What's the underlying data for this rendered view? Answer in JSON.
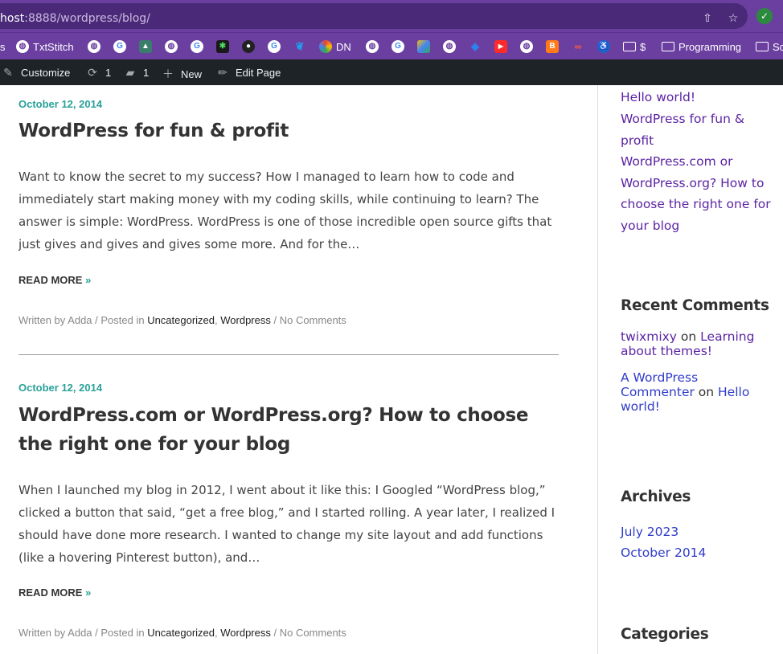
{
  "browser": {
    "url_host": "host",
    "url_rest": ":8888/wordpress/blog/",
    "bookmarks": [
      {
        "label": "s",
        "icon": "partial-icon"
      },
      {
        "label": "TxtStitch",
        "icon": "globe-icon"
      },
      {
        "label": "",
        "icon": "globe-icon"
      },
      {
        "label": "",
        "icon": "google-icon"
      },
      {
        "label": "",
        "icon": "app-icon"
      },
      {
        "label": "",
        "icon": "globe-icon"
      },
      {
        "label": "",
        "icon": "google-icon"
      },
      {
        "label": "",
        "icon": "app-icon"
      },
      {
        "label": "",
        "icon": "ghost-icon"
      },
      {
        "label": "",
        "icon": "google-icon"
      },
      {
        "label": "",
        "icon": "twitter-icon"
      },
      {
        "label": "DN",
        "icon": "dn-icon"
      },
      {
        "label": "",
        "icon": "globe-icon"
      },
      {
        "label": "",
        "icon": "google-icon"
      },
      {
        "label": "",
        "icon": "google-ads-icon"
      },
      {
        "label": "",
        "icon": "globe-icon"
      },
      {
        "label": "",
        "icon": "dropbox-icon"
      },
      {
        "label": "",
        "icon": "youtube-icon"
      },
      {
        "label": "",
        "icon": "globe-icon"
      },
      {
        "label": "",
        "icon": "blogger-icon"
      },
      {
        "label": "",
        "icon": "link-icon"
      },
      {
        "label": "",
        "icon": "accessibility-icon"
      },
      {
        "label": "$",
        "icon": "folder-icon"
      },
      {
        "label": "Programming",
        "icon": "folder-icon"
      },
      {
        "label": "Sc",
        "icon": "folder-icon"
      }
    ]
  },
  "adminbar": {
    "customize": "Customize",
    "updates": "1",
    "comments": "1",
    "new": "New",
    "edit_page": "Edit Page"
  },
  "posts": [
    {
      "date": "October 12, 2014",
      "title": "WordPress for fun & profit",
      "excerpt": "Want to know the secret to my success? How I managed to learn how to code and immediately start making money with my coding skills, while continuing to learn? The answer is simple: WordPress. WordPress is one of those incredible open source gifts that just gives and gives and gives some more. And for the…",
      "read_more": "Read More",
      "read_more_arrow": "»",
      "meta_written": "Written by Adda / Posted in ",
      "cat1": "Uncategorized",
      "comma": ", ",
      "cat2": "Wordpress",
      "comments": " / No Comments"
    },
    {
      "date": "October 12, 2014",
      "title": "WordPress.com or WordPress.org? How to choose the right one for your blog",
      "excerpt": "When I launched my blog in 2012, I went about it like this: I Googled “WordPress blog,” clicked a button that said, “get a free blog,” and I started rolling. A year later, I realized I should have done more research. I wanted to change my site layout and add functions (like a hovering Pinterest button), and…",
      "read_more": "Read More",
      "read_more_arrow": "»",
      "meta_written": "Written by Adda / Posted in ",
      "cat1": "Uncategorized",
      "comma": ", ",
      "cat2": "Wordpress",
      "comments": " / No Comments"
    }
  ],
  "sidebar": {
    "recent_posts": [
      "Hello world!",
      "WordPress for fun & profit",
      "WordPress.com or WordPress.org? How to choose the right one for your blog"
    ],
    "recent_comments_title": "Recent Comments",
    "comments": [
      {
        "author": "twixmixy",
        "on": " on ",
        "post": "Learning about themes!"
      },
      {
        "author": "A WordPress Commenter",
        "on": " on ",
        "post": "Hello world!"
      }
    ],
    "archives_title": "Archives",
    "archives": [
      "July 2023",
      "October 2014"
    ],
    "categories_title": "Categories"
  }
}
